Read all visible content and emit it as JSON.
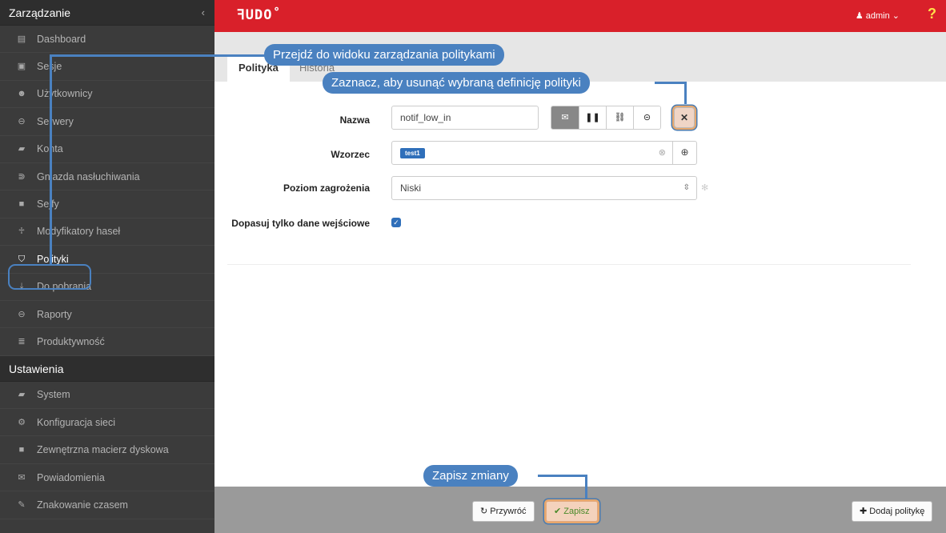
{
  "sidebar": {
    "section1": "Zarządzanie",
    "collapse_icon": "‹",
    "items": [
      {
        "label": "Dashboard",
        "icon": "dashboard-icon",
        "glyph": "▤"
      },
      {
        "label": "Sesje",
        "icon": "sessions-icon",
        "glyph": "▣"
      },
      {
        "label": "Użytkownicy",
        "icon": "users-icon",
        "glyph": "☻"
      },
      {
        "label": "Serwery",
        "icon": "servers-icon",
        "glyph": "⊖"
      },
      {
        "label": "Konta",
        "icon": "accounts-icon",
        "glyph": "▰"
      },
      {
        "label": "Gniazda nasłuchiwania",
        "icon": "listeners-icon",
        "glyph": "⋑"
      },
      {
        "label": "Sejfy",
        "icon": "safes-icon",
        "glyph": "■"
      },
      {
        "label": "Modyfikatory haseł",
        "icon": "password-changers-icon",
        "glyph": "♱"
      },
      {
        "label": "Polityki",
        "icon": "shield-icon",
        "glyph": "⛉"
      },
      {
        "label": "Do pobrania",
        "icon": "download-icon",
        "glyph": "⤓"
      },
      {
        "label": "Raporty",
        "icon": "reports-icon",
        "glyph": "⊖"
      },
      {
        "label": "Produktywność",
        "icon": "productivity-icon",
        "glyph": "≣"
      }
    ],
    "section2": "Ustawienia",
    "settings_items": [
      {
        "label": "System",
        "icon": "system-icon",
        "glyph": "▰"
      },
      {
        "label": "Konfiguracja sieci",
        "icon": "network-icon",
        "glyph": "⚙"
      },
      {
        "label": "Zewnętrzna macierz dyskowa",
        "icon": "storage-icon",
        "glyph": "■"
      },
      {
        "label": "Powiadomienia",
        "icon": "notifications-icon",
        "glyph": "✉"
      },
      {
        "label": "Znakowanie czasem",
        "icon": "timestamp-icon",
        "glyph": "✎"
      }
    ]
  },
  "topbar": {
    "logo": "ꟻUDO˚",
    "user": "♟ admin ⌄",
    "help": "?"
  },
  "tabs": {
    "active": "Polityka",
    "second": "Historia"
  },
  "form": {
    "name_label": "Nazwa",
    "name_value": "notif_low_in",
    "pattern_label": "Wzorzec",
    "pattern_tag": "test1",
    "risk_label": "Poziom zagrożenia",
    "risk_value": "Niski",
    "input_only_label": "Dopasuj tylko dane wejściowe",
    "action_glyphs": [
      "✉",
      "❚❚",
      "⛓",
      "⊝"
    ],
    "delete_glyph": "✕",
    "clear_glyph": "⊗",
    "search_glyph": "⊕",
    "select_glyph": "⇳",
    "gear_glyph": "✻",
    "check_glyph": "✓"
  },
  "footer": {
    "revert": "↻ Przywróć",
    "save": "✔ Zapisz",
    "add": "✚ Dodaj politykę"
  },
  "callouts": {
    "policies": "Przejdź do widoku zarządzania politykami",
    "delete": "Zaznacz, aby usunąć wybraną definicję polityki",
    "save": "Zapisz zmiany"
  },
  "colors": {
    "topbar": "#d9202a",
    "sidebar": "#3b3b3b",
    "callout": "#4a81c0",
    "primary": "#2f6fba"
  }
}
